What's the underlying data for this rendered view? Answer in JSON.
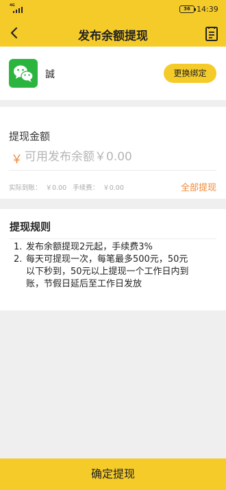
{
  "statusbar": {
    "network": "4G",
    "battery": "36",
    "time": "14:39"
  },
  "header": {
    "title": "发布余额提现",
    "back_icon": "back-arrow-icon",
    "record_icon": "record-list-icon"
  },
  "account": {
    "icon": "wechat-icon",
    "name": "誠",
    "change_label": "更换绑定"
  },
  "amount": {
    "label": "提现金额",
    "currency": "￥",
    "placeholder": "可用发布余额￥0.00",
    "actual_label": "实际到账：",
    "actual_value": "￥0.00",
    "fee_label": "手续费：",
    "fee_value": "￥0.00",
    "withdraw_all": "全部提现"
  },
  "rules": {
    "title": "提现规则",
    "items": [
      {
        "num": "1.",
        "lines": [
          "发布余额提现2元起，手续费3%"
        ]
      },
      {
        "num": "2.",
        "lines": [
          "每天可提现一次，每笔最多500元，50元",
          "以下秒到，50元以上提现一个工作日内到",
          "账，节假日延后至工作日发放"
        ]
      }
    ]
  },
  "footer": {
    "confirm_label": "确定提现"
  },
  "colors": {
    "accent": "#f5cb2a",
    "orange": "#f08a3a",
    "wechat": "#2bb53e",
    "background": "#efefef"
  }
}
